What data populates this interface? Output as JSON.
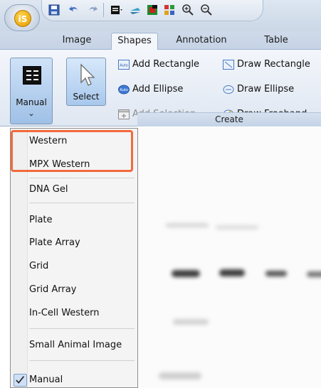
{
  "app": {
    "logo_text": "iS"
  },
  "ribbon_tabs": [
    "Image",
    "Shapes",
    "Annotation",
    "Table"
  ],
  "ribbon": {
    "manual_label": "Manual",
    "select_label": "Select",
    "items": {
      "add_rectangle": "Add Rectangle",
      "add_ellipse": "Add Ellipse",
      "add_selection": "Add Selection",
      "draw_rectangle": "Draw Rectangle",
      "draw_ellipse": "Draw Ellipse",
      "draw_freehand": "Draw Freehand",
      "auto_badge": "Auto"
    },
    "group_label": "Create"
  },
  "menu": {
    "items": [
      "Western",
      "MPX Western",
      "DNA Gel",
      "Plate",
      "Plate Array",
      "Grid",
      "Grid Array",
      "In-Cell Western",
      "Small Animal Image",
      "Manual"
    ],
    "checked_item": "Manual"
  },
  "colors": {
    "highlight": "#f26a3c",
    "accent": "#9fc0e6"
  }
}
